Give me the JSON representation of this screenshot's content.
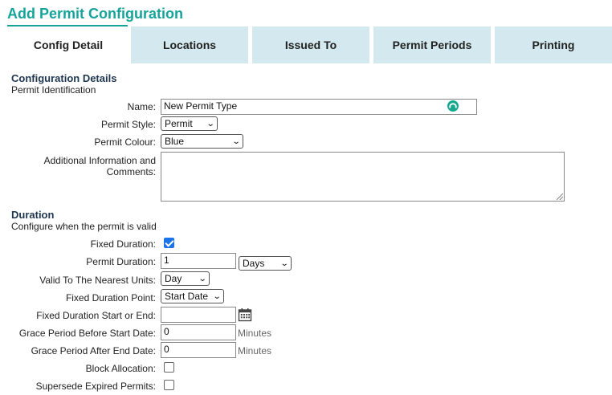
{
  "page": {
    "title": "Add Permit Configuration"
  },
  "tabs": [
    {
      "label": "Config Detail",
      "active": true
    },
    {
      "label": "Locations",
      "active": false
    },
    {
      "label": "Issued To",
      "active": false
    },
    {
      "label": "Permit Periods",
      "active": false
    },
    {
      "label": "Printing",
      "active": false
    }
  ],
  "config": {
    "title": "Configuration Details",
    "subtitle": "Permit Identification",
    "name_label": "Name:",
    "name_value": "New Permit Type",
    "style_label": "Permit Style:",
    "style_value": "Permit",
    "colour_label": "Permit Colour:",
    "colour_value": "Blue",
    "comments_label": "Additional Information and Comments:",
    "comments_value": ""
  },
  "duration": {
    "title": "Duration",
    "subtitle": "Configure when the permit is valid",
    "fixed_label": "Fixed Duration:",
    "fixed_checked": true,
    "permit_duration_label": "Permit Duration:",
    "permit_duration_value": "1",
    "permit_duration_unit": "Days",
    "nearest_label": "Valid To The Nearest Units:",
    "nearest_value": "Day",
    "point_label": "Fixed Duration Point:",
    "point_value": "Start Date",
    "start_end_label": "Fixed Duration Start or End:",
    "start_end_value": "",
    "grace_before_label": "Grace Period Before Start Date:",
    "grace_before_value": "0",
    "grace_before_unit": "Minutes",
    "grace_after_label": "Grace Period After End Date:",
    "grace_after_value": "0",
    "grace_after_unit": "Minutes",
    "block_label": "Block Allocation:",
    "block_checked": false,
    "supersede_label": "Supersede Expired Permits:",
    "supersede_checked": false
  },
  "colors": {
    "accent": "#16a39a",
    "tab_bg": "#d3e9ef",
    "checkbox": "#1a73e8"
  }
}
